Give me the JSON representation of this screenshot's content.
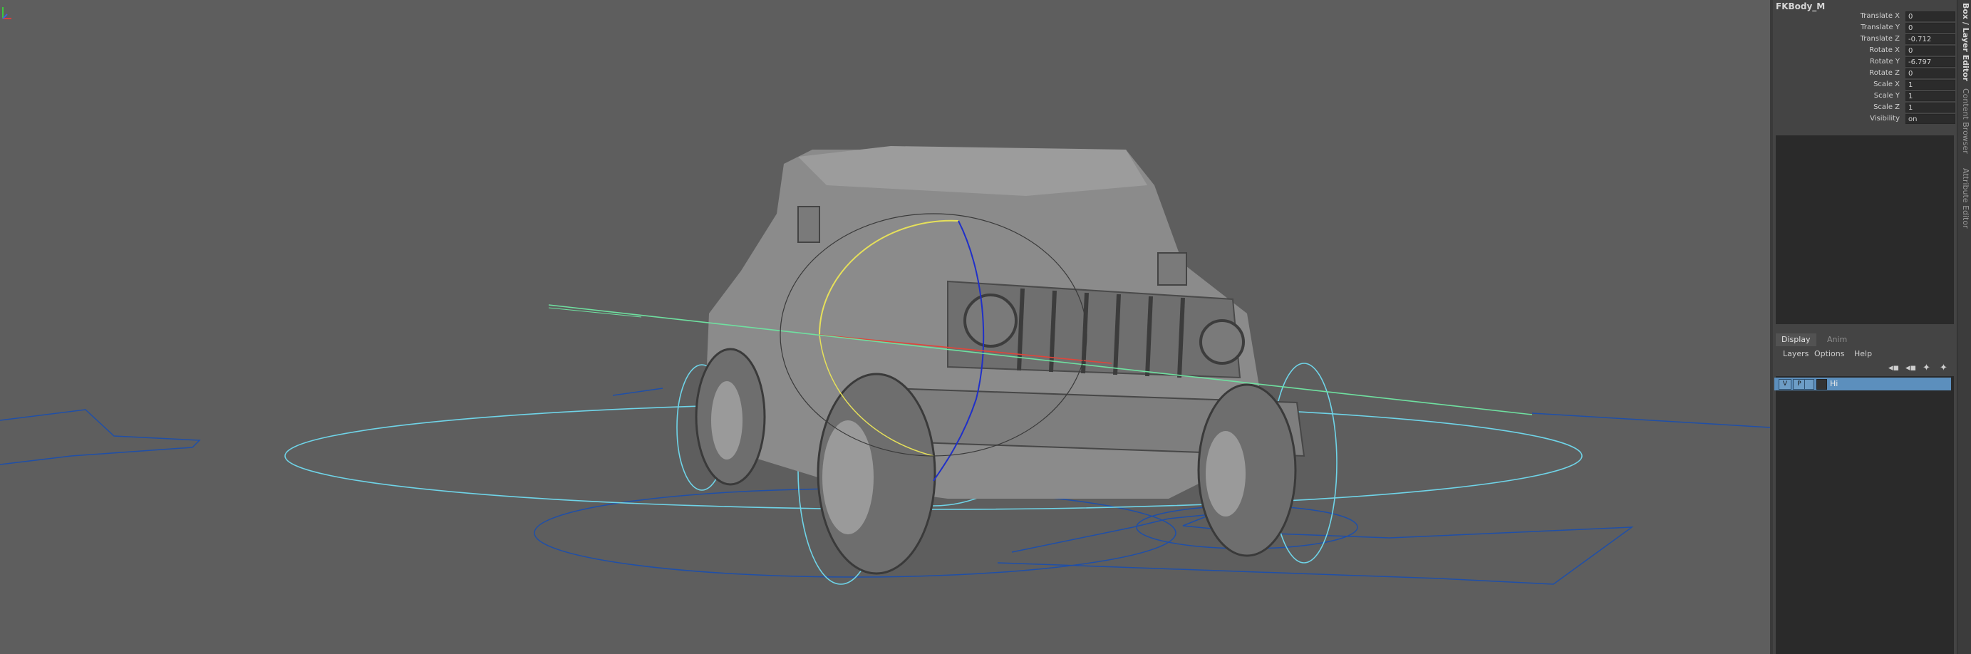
{
  "viewport": {
    "description_icon": "3d-viewport"
  },
  "channel_box": {
    "node_name": "FKBody_M",
    "attributes": [
      {
        "label": "Translate X",
        "value": "0"
      },
      {
        "label": "Translate Y",
        "value": "0"
      },
      {
        "label": "Translate Z",
        "value": "-0.712"
      },
      {
        "label": "Rotate X",
        "value": "0"
      },
      {
        "label": "Rotate Y",
        "value": "-6.797"
      },
      {
        "label": "Rotate Z",
        "value": "0"
      },
      {
        "label": "Scale X",
        "value": "1"
      },
      {
        "label": "Scale Y",
        "value": "1"
      },
      {
        "label": "Scale Z",
        "value": "1"
      },
      {
        "label": "Visibility",
        "value": "on"
      }
    ]
  },
  "layer_editor": {
    "tabs": [
      "Display",
      "Anim"
    ],
    "menu": [
      "Layers",
      "Options",
      "Help"
    ],
    "icons": [
      "move-layer-up-icon",
      "move-layer-down-icon",
      "new-layer-icon",
      "new-layer-selected-icon"
    ],
    "layers": [
      {
        "visible": "V",
        "playback": "P",
        "name": "Hi"
      }
    ]
  },
  "side_tabs": [
    "Box / Layer Editor",
    "Content Browser",
    "Attribute Editor"
  ],
  "colors": {
    "viewport_bg": "#5e5e5e",
    "nurbs_blue": "#1f4fa8",
    "controller_cyan": "#6fd4e8",
    "selection_yellow": "#e6e05a",
    "highlight_green": "#6fe0a0",
    "layer_selected": "#5c8fbd"
  }
}
